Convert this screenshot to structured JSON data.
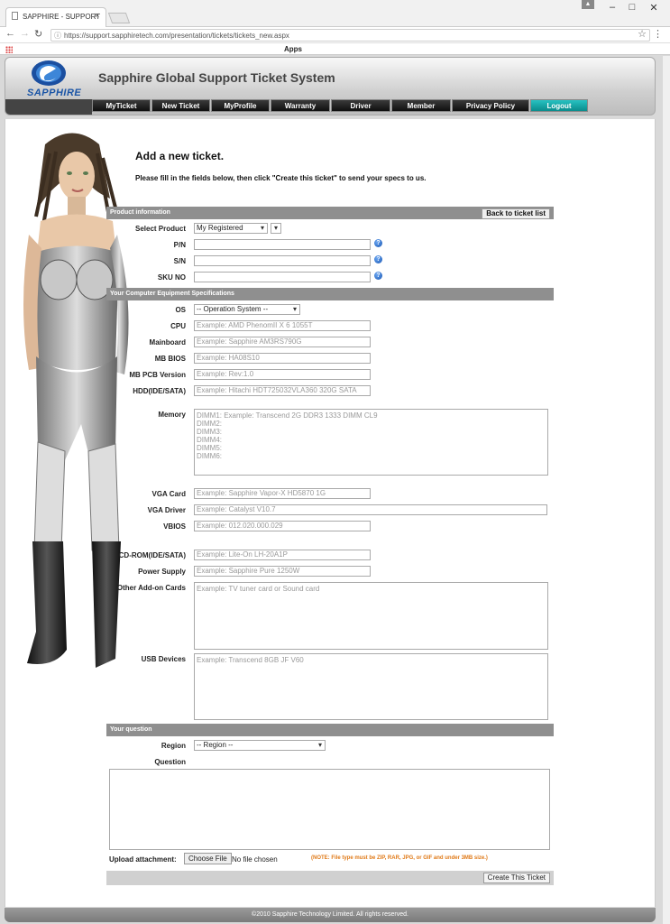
{
  "browser": {
    "tab_title": "SAPPHIRE - SUPPORT",
    "url": "https://support.sapphiretech.com/presentation/tickets/tickets_new.aspx",
    "bookmarks_label": "Apps"
  },
  "site": {
    "logo_text": "SAPPHIRE",
    "title": "Sapphire Global Support Ticket System"
  },
  "nav": [
    "MyTicket",
    "New Ticket",
    "MyProfile",
    "Warranty",
    "Driver",
    "Member",
    "Privacy Policy",
    "Logout"
  ],
  "page": {
    "title": "Add a new ticket.",
    "intro": "Please fill in the fields below, then click \"Create this ticket\" to send your specs to us."
  },
  "product": {
    "section_title": "Product information",
    "back_button": "Back to ticket list",
    "select_product_label": "Select Product",
    "select_product_value": "My Registered",
    "pn_label": "P/N",
    "sn_label": "S/N",
    "sku_label": "SKU NO",
    "help_glyph": "?"
  },
  "specs": {
    "section_title": "Your Computer Equipment Specifications",
    "os_label": "OS",
    "os_value": "-- Operation System --",
    "cpu_label": "CPU",
    "cpu_ph": "Example: AMD PhenomII X 6 1055T",
    "mainboard_label": "Mainboard",
    "mainboard_ph": "Example: Sapphire AM3RS790G",
    "mbbios_label": "MB BIOS",
    "mbbios_ph": "Example: HA08S10",
    "mbpcb_label": "MB PCB Version",
    "mbpcb_ph": "Example: Rev:1.0",
    "hdd_label": "HDD(IDE/SATA)",
    "hdd_ph": "Example: Hitachi HDT725032VLA360 320G SATA",
    "memory_label": "Memory",
    "memory_ph": "DIMM1: Example: Transcend 2G DDR3 1333 DIMM CL9\nDIMM2:\nDIMM3:\nDIMM4:\nDIMM5:\nDIMM6:",
    "vga_label": "VGA Card",
    "vga_ph": "Example: Sapphire Vapor-X HD5870 1G",
    "vgadriver_label": "VGA Driver",
    "vgadriver_ph": "Example: Catalyst V10.7",
    "vbios_label": "VBIOS",
    "vbios_ph": "Example: 012.020.000.029",
    "cdrom_label": "CD-ROM(IDE/SATA)",
    "cdrom_ph": "Example: Lite-On LH-20A1P",
    "psu_label": "Power Supply",
    "psu_ph": "Example: Sapphire Pure 1250W",
    "addon_label": "Other Add-on Cards",
    "addon_ph": "Example: TV tuner card or Sound card",
    "usb_label": "USB Devices",
    "usb_ph": "Example: Transcend 8GB JF V60"
  },
  "question": {
    "section_title": "Your question",
    "region_label": "Region",
    "region_value": "-- Region --",
    "question_label": "Question",
    "upload_label": "Upload attachment:",
    "choose_file": "Choose File",
    "no_file": "No file chosen",
    "note": "(NOTE: File type must be ZIP, RAR, JPG, or GIF and under 3MB size.)",
    "create_button": "Create This Ticket"
  },
  "footer": "©2010 Sapphire Technology Limited. All rights reserved.",
  "colors": {
    "accent": "#1b55a6",
    "logout": "#17a9a9",
    "note": "#e07a18",
    "section": "#8f8f8f"
  }
}
